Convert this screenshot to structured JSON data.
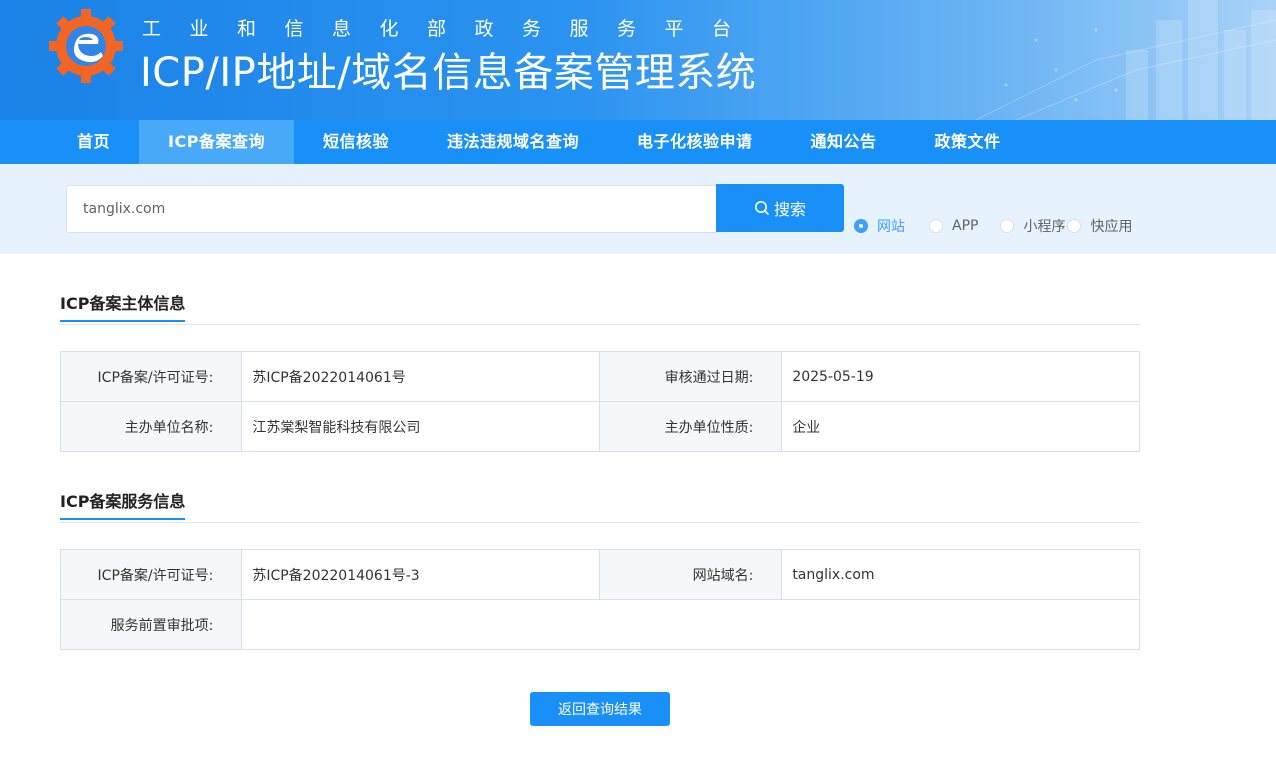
{
  "header": {
    "subtitle": "工业和信息化部政务服务平台",
    "title": "ICP/IP地址/域名信息备案管理系统"
  },
  "nav": {
    "items": [
      {
        "label": "首页"
      },
      {
        "label": "ICP备案查询",
        "active": true
      },
      {
        "label": "短信核验"
      },
      {
        "label": "违法违规域名查询"
      },
      {
        "label": "电子化核验申请"
      },
      {
        "label": "通知公告"
      },
      {
        "label": "政策文件"
      }
    ]
  },
  "search": {
    "value": "tanglix.com",
    "button_label": "搜索",
    "types": [
      {
        "label": "网站",
        "checked": true
      },
      {
        "label": "APP"
      },
      {
        "label": "小程序"
      },
      {
        "label": "快应用"
      }
    ]
  },
  "subject": {
    "title": "ICP备案主体信息",
    "license_label": "ICP备案/许可证号:",
    "license_value": "苏ICP备2022014061号",
    "date_label": "审核通过日期:",
    "date_value": "2025-05-19",
    "org_label": "主办单位名称:",
    "org_value": "江苏棠梨智能科技有限公司",
    "nature_label": "主办单位性质:",
    "nature_value": "企业"
  },
  "service": {
    "title": "ICP备案服务信息",
    "license_label": "ICP备案/许可证号:",
    "license_value": "苏ICP备2022014061号-3",
    "domain_label": "网站域名:",
    "domain_value": "tanglix.com",
    "approval_label": "服务前置审批项:",
    "approval_value": ""
  },
  "back_button": "返回查询结果",
  "colors": {
    "primary": "#1890f8",
    "nav_active": "#47a9f8",
    "band": "#e6f2fd"
  }
}
